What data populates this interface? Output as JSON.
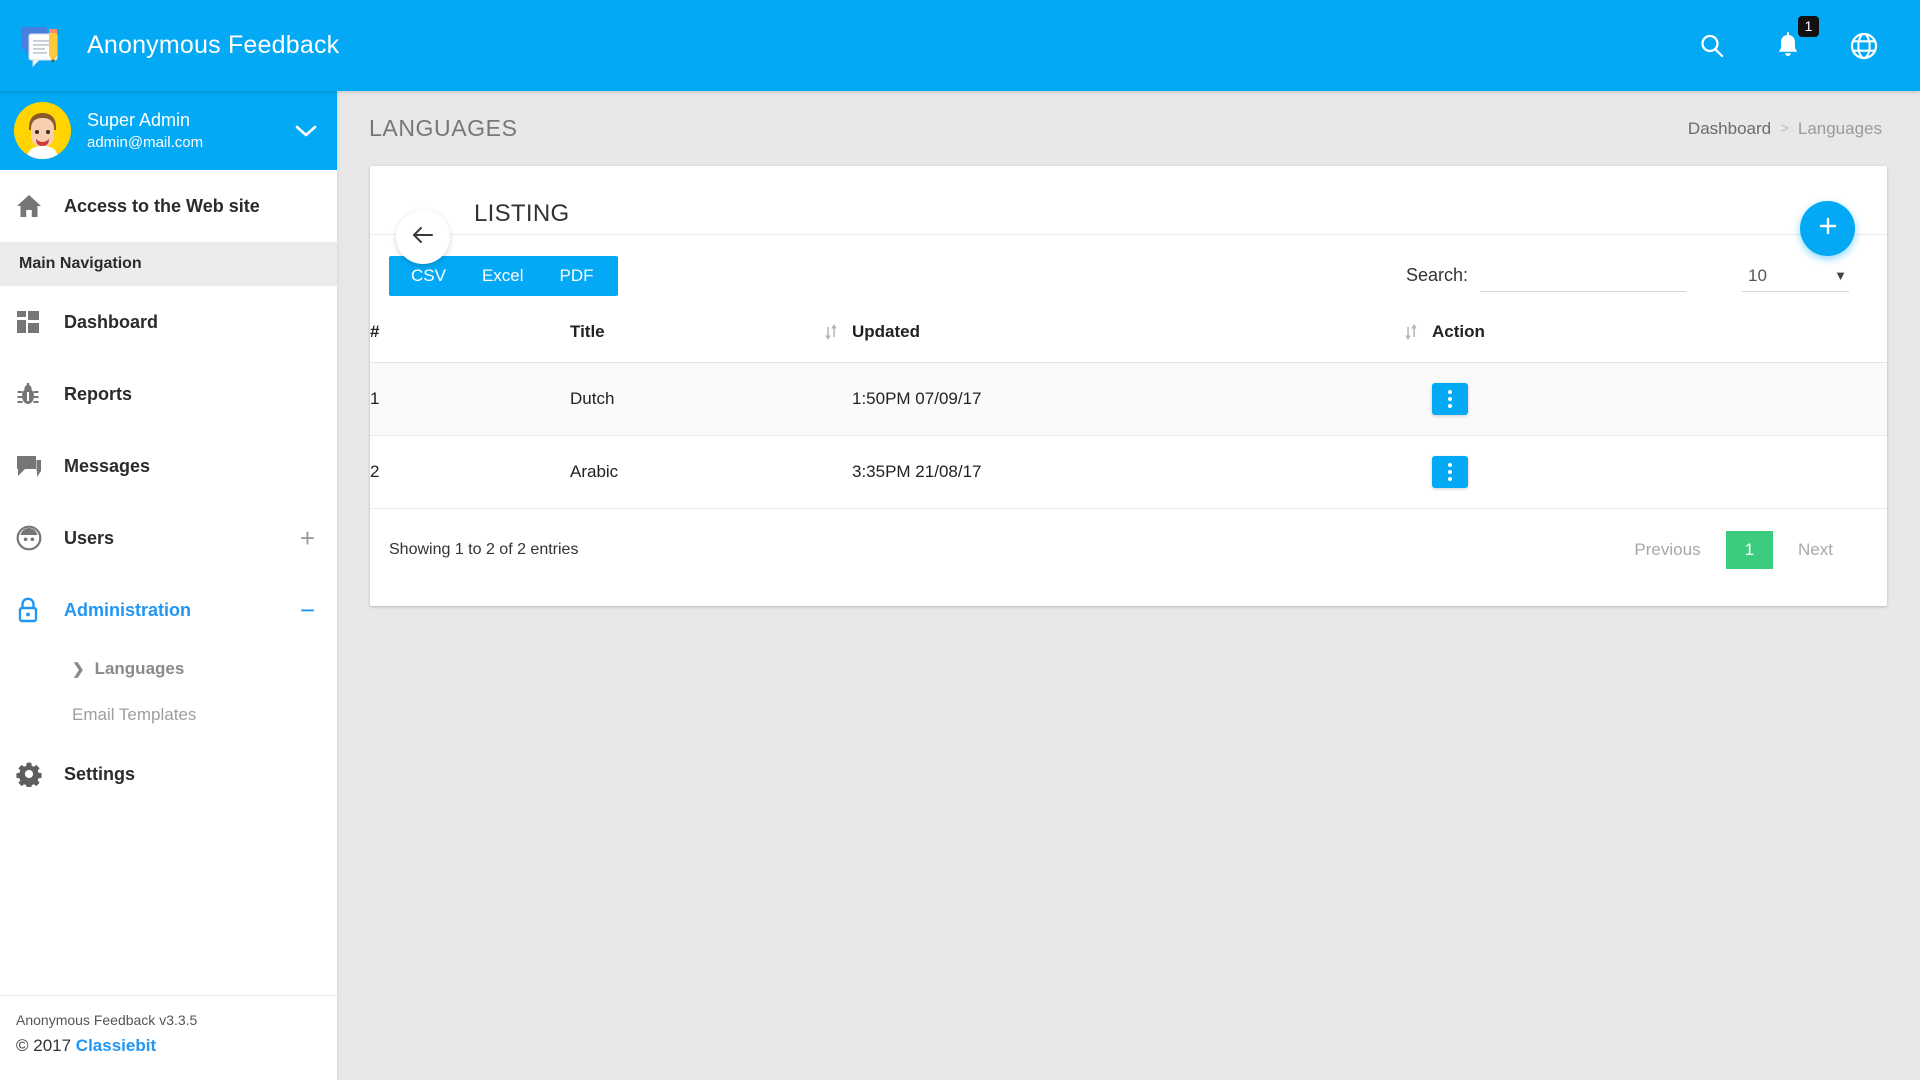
{
  "app": {
    "brand_title": "Anonymous Feedback",
    "logo_icon": "feedback-document-pencil-logo",
    "accent_color": "#03a9f4",
    "success_color": "#3ccb7f"
  },
  "topbar": {
    "search_icon": "search-icon",
    "notifications_icon": "bell-icon",
    "notifications_count": "1",
    "language_icon": "globe-icon"
  },
  "sidebar": {
    "user": {
      "name": "Super Admin",
      "email": "admin@mail.com",
      "avatar_icon": "user-avatar",
      "expand_icon": "chevron-down-icon"
    },
    "web_site_link": {
      "label": "Access to the Web site",
      "icon": "home-icon"
    },
    "section_header": "Main Navigation",
    "items": [
      {
        "label": "Dashboard",
        "icon": "dashboard-grid-icon",
        "active": false,
        "right": ""
      },
      {
        "label": "Reports",
        "icon": "bug-icon",
        "active": false,
        "right": ""
      },
      {
        "label": "Messages",
        "icon": "chat-icon",
        "active": false,
        "right": ""
      },
      {
        "label": "Users",
        "icon": "user-circle-icon",
        "active": false,
        "right": "+"
      },
      {
        "label": "Administration",
        "icon": "lock-icon",
        "active": true,
        "right": "−"
      }
    ],
    "subitems": [
      {
        "label": "Languages",
        "active": true,
        "caret_icon": "chevron-right-icon"
      },
      {
        "label": "Email Templates",
        "active": false,
        "caret_icon": ""
      }
    ],
    "settings_item": {
      "label": "Settings",
      "icon": "gear-icon"
    },
    "footer": {
      "version_line": "Anonymous Feedback v3.3.5",
      "copyright_prefix": "© 2017 ",
      "company": "Classiebit"
    }
  },
  "page": {
    "title": "LANGUAGES",
    "breadcrumb": {
      "root": "Dashboard",
      "separator": ">",
      "current": "Languages"
    }
  },
  "card": {
    "heading": "LISTING",
    "back_icon": "arrow-left-icon",
    "add_icon": "plus-icon",
    "export_buttons": [
      "CSV",
      "Excel",
      "PDF"
    ],
    "search": {
      "label": "Search:",
      "value": "",
      "placeholder": ""
    },
    "page_length": {
      "value": "10",
      "caret_icon": "caret-down-icon"
    }
  },
  "table": {
    "columns": [
      {
        "label": "#",
        "sortable": false
      },
      {
        "label": "Title",
        "sortable": true
      },
      {
        "label": "Updated",
        "sortable": true
      },
      {
        "label": "Action",
        "sortable": false
      }
    ],
    "sort_icon": "sort-updown-icon",
    "action_icon": "kebab-menu-icon",
    "rows": [
      {
        "num": "1",
        "title": "Dutch",
        "updated": "1:50PM 07/09/17"
      },
      {
        "num": "2",
        "title": "Arabic",
        "updated": "3:35PM 21/08/17"
      }
    ]
  },
  "footer": {
    "info": "Showing 1 to 2 of 2 entries",
    "pagination": {
      "previous": "Previous",
      "current_page": "1",
      "next": "Next"
    }
  }
}
